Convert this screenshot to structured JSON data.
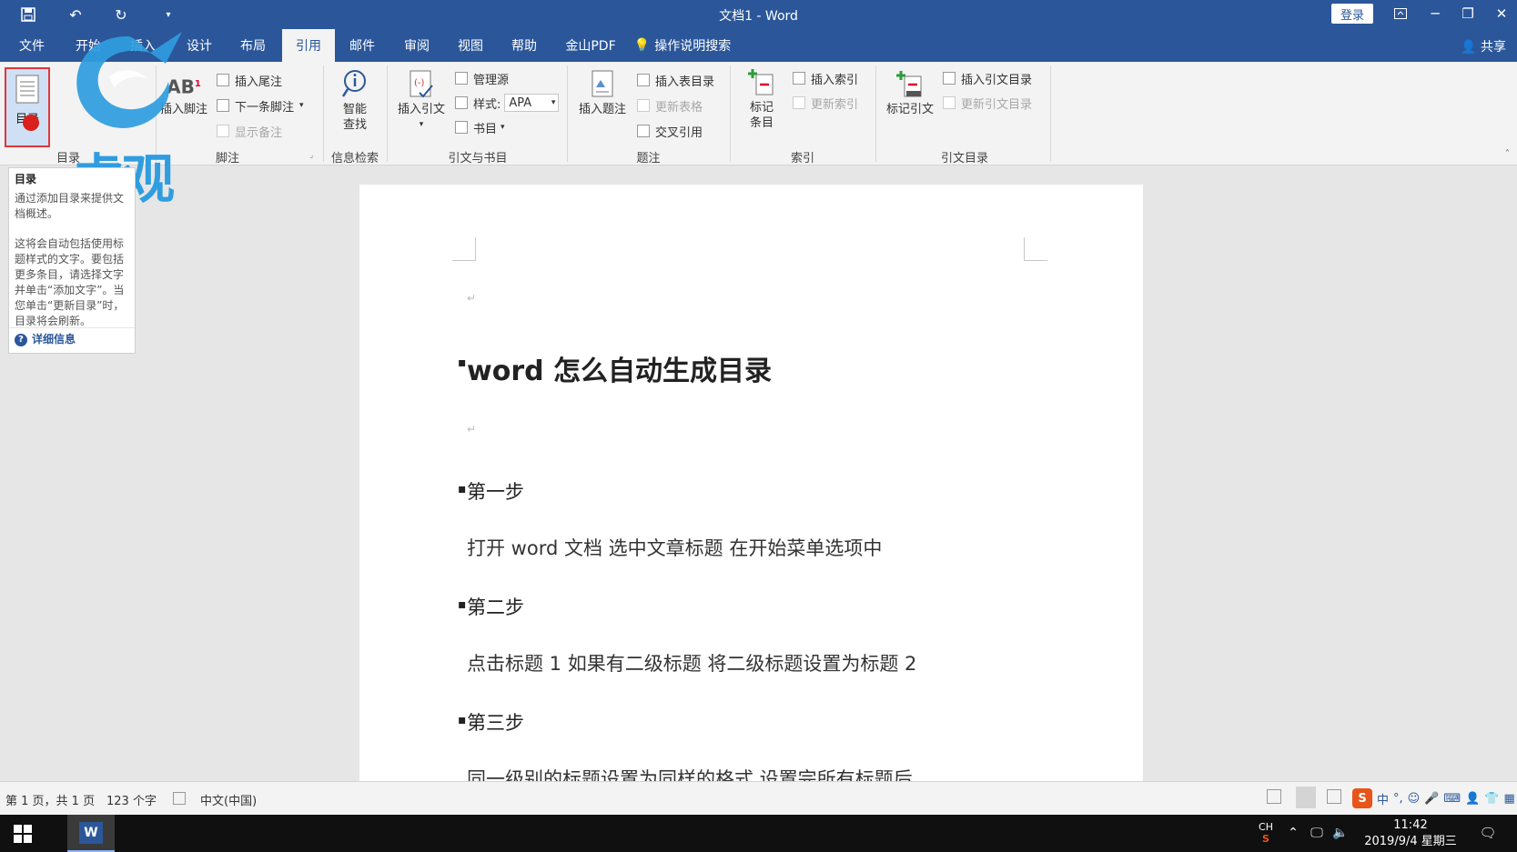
{
  "window": {
    "title": "文档1  -  Word",
    "login_label": "登录"
  },
  "tabs": [
    {
      "label": "文件"
    },
    {
      "label": "开始"
    },
    {
      "label": "插入"
    },
    {
      "label": "设计"
    },
    {
      "label": "布局"
    },
    {
      "label": "引用"
    },
    {
      "label": "邮件"
    },
    {
      "label": "审阅"
    },
    {
      "label": "视图"
    },
    {
      "label": "帮助"
    },
    {
      "label": "金山PDF"
    }
  ],
  "tell_me": "操作说明搜索",
  "share_label": "共享",
  "ribbon": {
    "toc": {
      "label": "目录",
      "group": "目录"
    },
    "footnotes": {
      "insert_footnote": "插入脚注",
      "insert_endnote": "插入尾注",
      "next_footnote": "下一条脚注",
      "show_notes": "显示备注",
      "group": "脚注"
    },
    "research": {
      "smart_lookup_1": "智能",
      "smart_lookup_2": "查找",
      "group": "信息检索"
    },
    "citations": {
      "insert_citation": "插入引文",
      "manage_sources": "管理源",
      "style_label": "样式:",
      "style_value": "APA",
      "bibliography": "书目",
      "group": "引文与书目"
    },
    "captions": {
      "insert_caption": "插入题注",
      "insert_table_of_figures": "插入表目录",
      "update_table": "更新表格",
      "cross_reference": "交叉引用",
      "group": "题注"
    },
    "index": {
      "mark_entry_1": "标记",
      "mark_entry_2": "条目",
      "insert_index": "插入索引",
      "update_index": "更新索引",
      "group": "索引"
    },
    "table_of_authorities": {
      "mark_citation": "标记引文",
      "insert_toa": "插入引文目录",
      "update_toa": "更新引文目录",
      "group": "引文目录"
    }
  },
  "tooltip": {
    "title": "目录",
    "p1": "通过添加目录来提供文档概述。",
    "p2": "这将会自动包括使用标题样式的文字。要包括更多条目，请选择文字并单击“添加文字”。当您单击“更新目录”时，目录将会刷新。",
    "more": "详细信息"
  },
  "watermark": {
    "text": "虎观"
  },
  "document": {
    "title": "word 怎么自动生成目录",
    "step1": "第一步",
    "step1_body": "打开 word 文档   选中文章标题  在开始菜单选项中",
    "step2": "第二步",
    "step2_body": "点击标题 1   如果有二级标题  将二级标题设置为标题 2",
    "step3": "第三步",
    "step3_body": "同一级别的标题设置为同样的格式   设置完所有标题后"
  },
  "statusbar": {
    "page": "第 1 页，共 1 页",
    "words": "123 个字",
    "language": "中文(中国)"
  },
  "taskbar": {
    "ime": "CH",
    "time": "11:42",
    "date": "2019/9/4 星期三"
  },
  "colors": {
    "accent": "#2b579a",
    "highlight": "#e0373a"
  }
}
